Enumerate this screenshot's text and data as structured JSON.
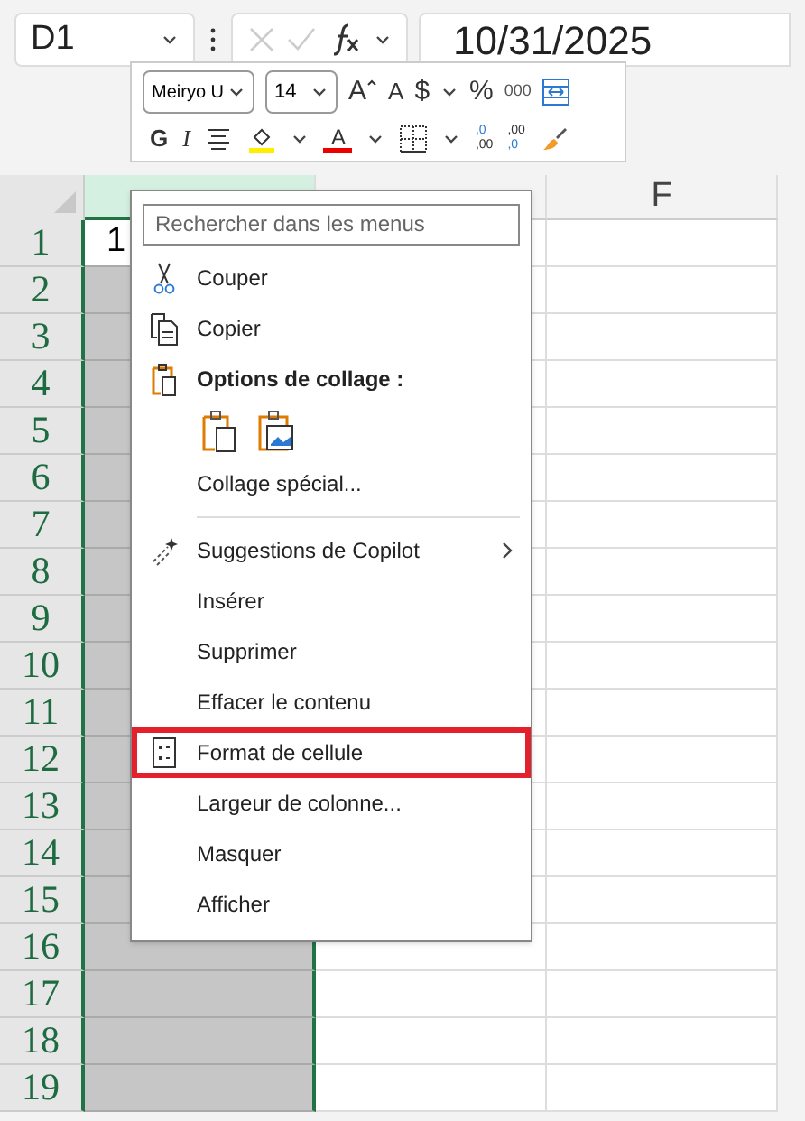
{
  "formula_bar": {
    "name_box": "D1",
    "formula": "10/31/2025"
  },
  "mini_toolbar": {
    "font": "Meiryo U",
    "size": "14",
    "grow": "A",
    "shrink": "A",
    "currency": "$",
    "percent": "%",
    "thousands": "000",
    "bold": "G",
    "italic": "I",
    "font_color": "A",
    "add_decimal": [
      ",0",
      ",00"
    ],
    "remove_decimal": [
      ",00",
      ",0"
    ]
  },
  "sheet": {
    "columns": [
      {
        "selected": true
      },
      {
        "selected": false
      },
      {
        "label": "F",
        "selected": false
      }
    ],
    "rows": [
      "1",
      "2",
      "3",
      "4",
      "5",
      "6",
      "7",
      "8",
      "9",
      "10",
      "11",
      "12",
      "13",
      "14",
      "15",
      "16",
      "17",
      "18",
      "19"
    ],
    "active_cell": "1"
  },
  "context_menu": {
    "search": {
      "placeholder": "Rechercher dans les menus"
    },
    "items": [
      {
        "kind": "item",
        "label": "Couper"
      },
      {
        "kind": "item",
        "label": "Copier"
      },
      {
        "kind": "header",
        "label": "Options de collage :"
      },
      {
        "kind": "paste-options"
      },
      {
        "kind": "item",
        "label": "Collage spécial..."
      },
      {
        "kind": "separator"
      },
      {
        "kind": "submenu",
        "label": "Suggestions de Copilot"
      },
      {
        "kind": "item",
        "label": "Insérer"
      },
      {
        "kind": "item",
        "label": "Supprimer"
      },
      {
        "kind": "item",
        "label": "Effacer le contenu"
      },
      {
        "kind": "item",
        "label": "Format de cellule",
        "highlighted": true
      },
      {
        "kind": "item",
        "label": "Largeur de colonne..."
      },
      {
        "kind": "item",
        "label": "Masquer"
      },
      {
        "kind": "item",
        "label": "Afficher"
      }
    ]
  }
}
